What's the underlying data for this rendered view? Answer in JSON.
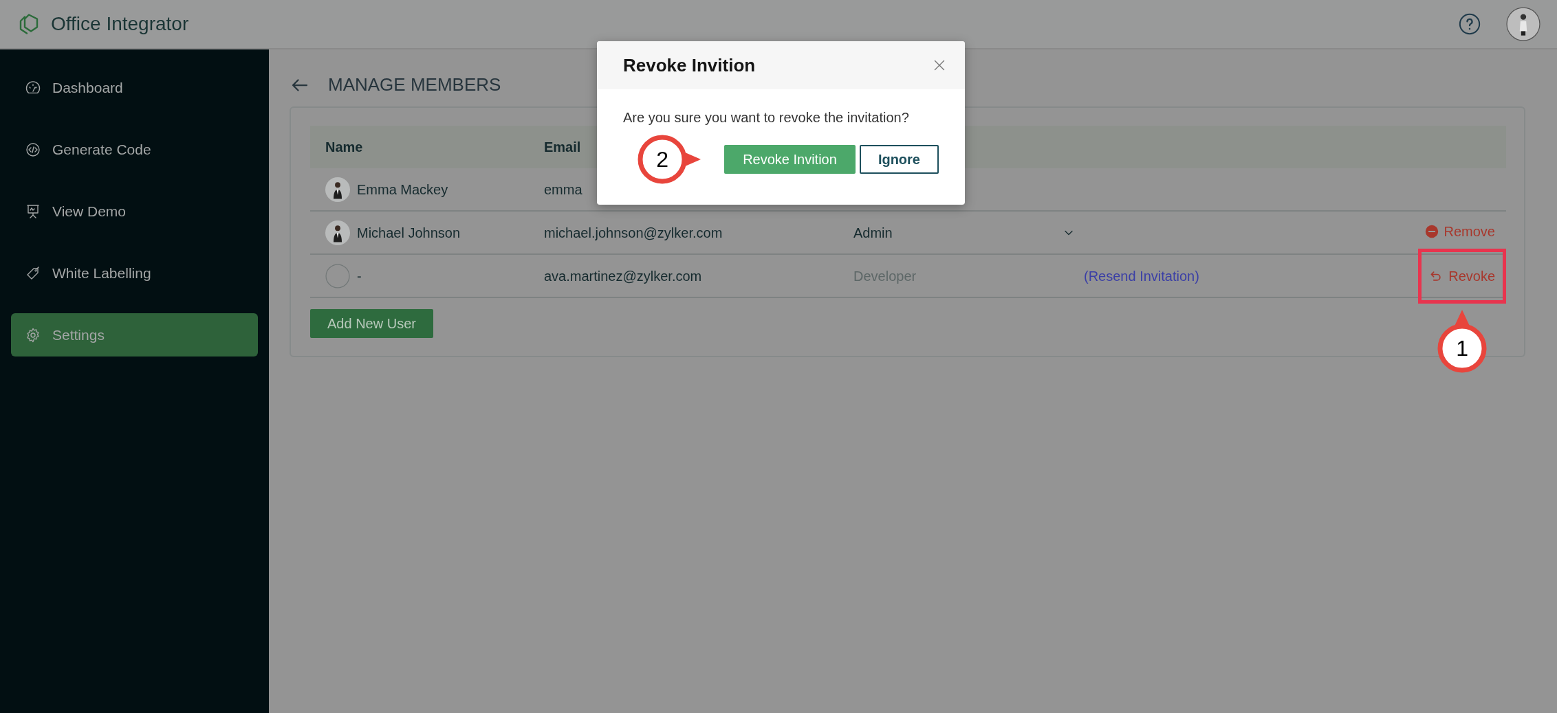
{
  "app": {
    "title": "Office Integrator"
  },
  "sidebar": {
    "items": [
      {
        "label": "Dashboard",
        "selected": false
      },
      {
        "label": "Generate Code",
        "selected": false
      },
      {
        "label": "View Demo",
        "selected": false
      },
      {
        "label": "White Labelling",
        "selected": false
      },
      {
        "label": "Settings",
        "selected": true
      }
    ]
  },
  "page": {
    "title": "MANAGE MEMBERS"
  },
  "table": {
    "columns": [
      "Name",
      "Email"
    ],
    "rows": [
      {
        "name": "Emma Mackey",
        "kind": "member",
        "email": "emma"
      },
      {
        "name": "Michael Johnson",
        "kind": "member",
        "email": "michael.johnson@zylker.com",
        "role": {
          "text": "Admin",
          "editable": true
        },
        "action": {
          "label": "Remove",
          "kind": "remove",
          "highlighted": false
        }
      },
      {
        "name": "-",
        "kind": "invited",
        "email": "ava.martinez@zylker.com",
        "role": {
          "text": "Developer",
          "editable": false
        },
        "link": "(Resend Invitation)",
        "action": {
          "label": "Revoke",
          "kind": "revoke",
          "highlighted": true,
          "callout": "1"
        }
      }
    ]
  },
  "add_button": "Add New User",
  "dialog": {
    "title": "Revoke Invition",
    "message": "Are you sure you want to revoke the invitation?",
    "confirm": {
      "label": "Revoke Invition",
      "callout": "2"
    },
    "cancel": "Ignore"
  }
}
